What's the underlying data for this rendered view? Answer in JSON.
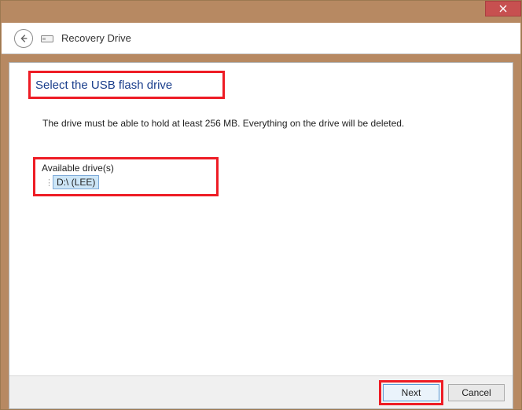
{
  "window": {
    "title": "Recovery Drive"
  },
  "page": {
    "heading": "Select the USB flash drive",
    "instruction": "The drive must be able to hold at least 256 MB. Everything on the drive will be deleted."
  },
  "drives": {
    "label": "Available drive(s)",
    "items": [
      {
        "text": "D:\\ (LEE)",
        "selected": true
      }
    ]
  },
  "buttons": {
    "next": "Next",
    "cancel": "Cancel"
  },
  "highlights": {
    "color": "#ee1c25"
  }
}
